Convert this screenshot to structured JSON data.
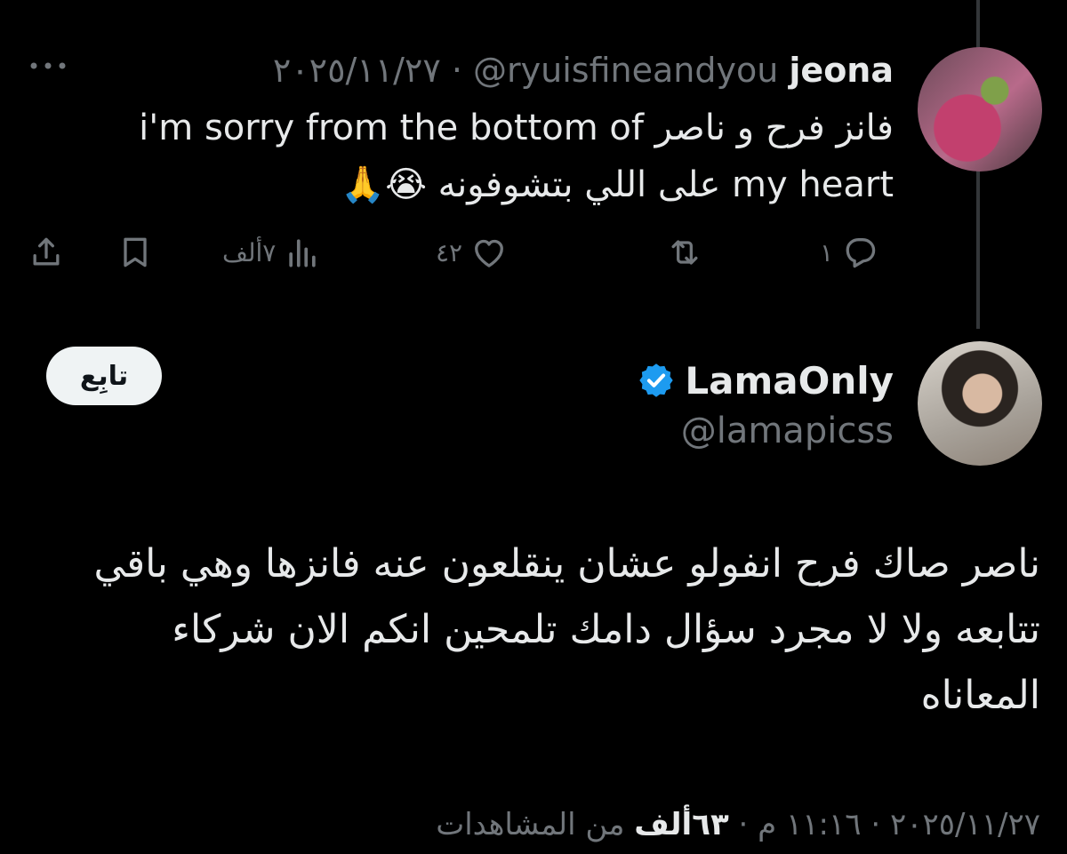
{
  "parent_tweet": {
    "author_name": "jeona",
    "handle": "@ryuisfineandyou",
    "separator": "·",
    "date": "٢٠٢٥/١١/٢٧",
    "text_line_1": "فانز فرح و ناصر i'm sorry from the bottom of",
    "text_line_2": "my heart على اللي بتشوفونه 😭🙏",
    "actions": {
      "replies": "١",
      "retweets": "",
      "likes": "٤٢",
      "views": "٧ألف"
    }
  },
  "main_tweet": {
    "author_name": "LamaOnly",
    "handle": "@lamapicss",
    "follow_label": "تابِع",
    "text": "ناصر صاك فرح انفولو عشان ينقلعون عنه فانزها وهي باقي تتابعه ولا لا مجرد سؤال دامك تلمحين انكم الان شركاء المعاناه",
    "meta": {
      "date": "٢٠٢٥/١١/٢٧",
      "time": "١١:١٦ م",
      "separator": "·",
      "views_count": "٦٣ألف",
      "views_label": "من المشاهدات"
    }
  },
  "icons": {
    "more": "more-icon",
    "reply": "reply-icon",
    "retweet": "retweet-icon",
    "like": "heart-icon",
    "views": "views-icon",
    "bookmark": "bookmark-icon",
    "share": "share-icon",
    "verified": "verified-badge-icon"
  },
  "colors": {
    "background": "#000000",
    "text": "#e7e9ea",
    "muted": "#71767b",
    "verified": "#1d9bf0",
    "follow_bg": "#eff3f4"
  }
}
